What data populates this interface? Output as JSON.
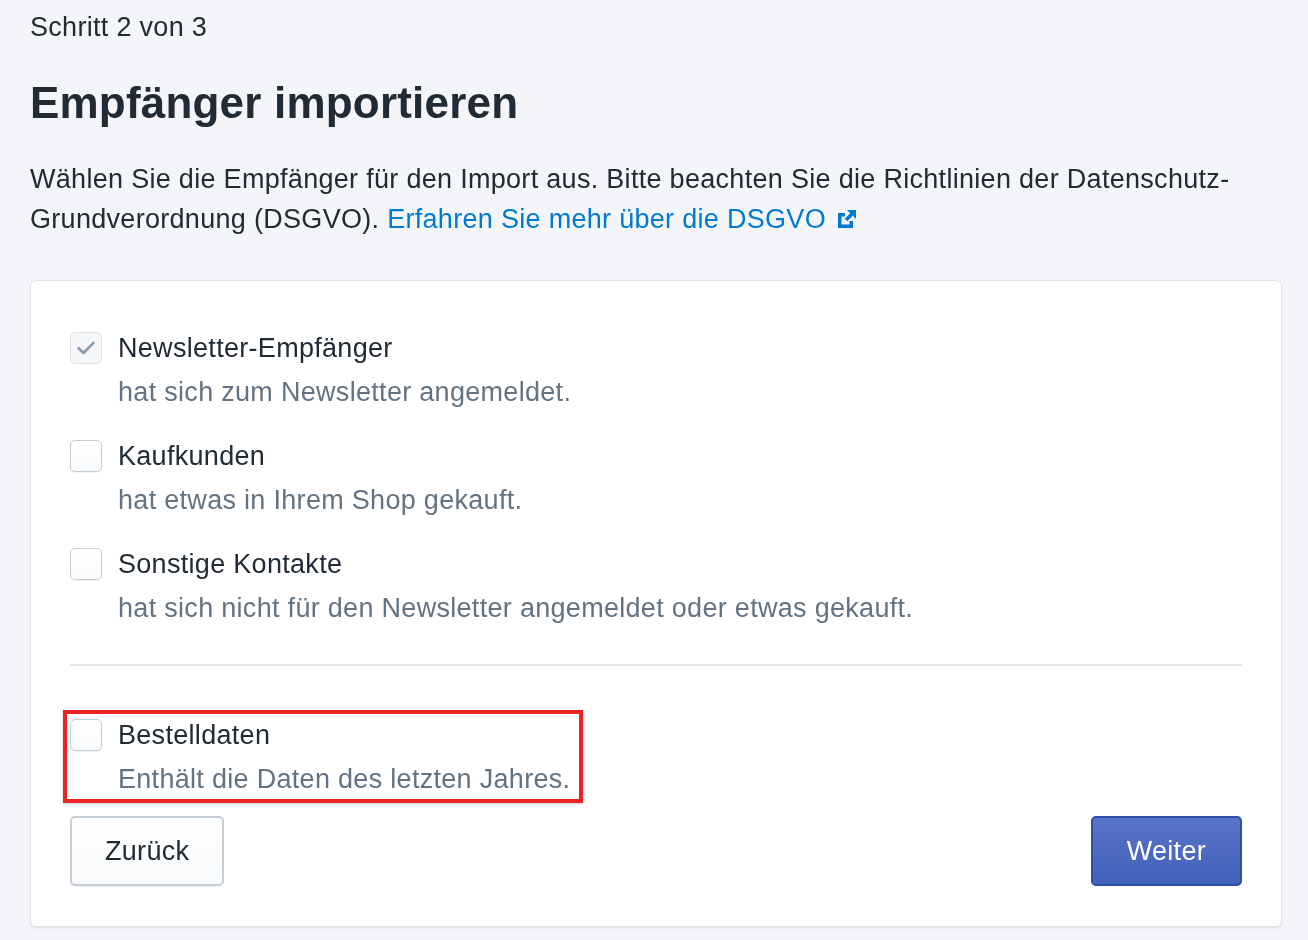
{
  "step": "Schritt 2 von 3",
  "title": "Empfänger importieren",
  "intro": {
    "text": "Wählen Sie die Empfänger für den Import aus. Bitte beachten Sie die Richtlinien der Datenschutz-Grundverordnung (DSGVO).",
    "link": "Erfahren Sie mehr über die DSGVO"
  },
  "recipient_options": [
    {
      "label": "Newsletter-Empfänger",
      "description": "hat sich zum Newsletter angemeldet.",
      "checked": true,
      "disabled": true
    },
    {
      "label": "Kaufkunden",
      "description": "hat etwas in Ihrem Shop gekauft.",
      "checked": false,
      "disabled": false
    },
    {
      "label": "Sonstige Kontakte",
      "description": "hat sich nicht für den Newsletter angemeldet oder etwas gekauft.",
      "checked": false,
      "disabled": false
    }
  ],
  "extra_options": [
    {
      "label": "Bestelldaten",
      "description": "Enthält die Daten des letzten Jahres.",
      "checked": false,
      "disabled": false,
      "highlighted": true
    }
  ],
  "buttons": [
    {
      "label": "Zurück",
      "kind": "secondary"
    },
    {
      "label": "Weiter",
      "kind": "primary"
    }
  ]
}
